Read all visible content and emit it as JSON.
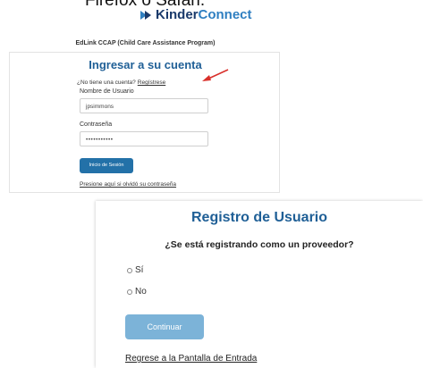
{
  "header": {
    "top_cut_text": "Firefox o Safari.",
    "logo_kinder": "Kinder",
    "logo_connect": "Connect",
    "program_name": "EdLink CCAP (Child Care Assistance Program)"
  },
  "login": {
    "title": "Ingresar a su cuenta",
    "no_account_text": "¿No tiene una cuenta?",
    "register_link": "Regístrese",
    "username_label": "Nombre de Usuario",
    "username_value": "jpsimmons",
    "password_label": "Contraseña",
    "password_value": "•••••••••••",
    "login_button": "Inicio de Sesión",
    "forgot_link": "Presione aquí si olvidó su contraseña"
  },
  "registration": {
    "title": "Registro de Usuario",
    "question": "¿Se está registrando como un proveedor?",
    "options": [
      "Sí",
      "No"
    ],
    "continue_button": "Continuar",
    "back_link": "Regrese a la Pantalla de Entrada"
  },
  "colors": {
    "title_blue": "#1f5f96",
    "login_button": "#2371a8",
    "continue_button": "#7cb3d8",
    "annotation_arrow": "#d9302b"
  }
}
